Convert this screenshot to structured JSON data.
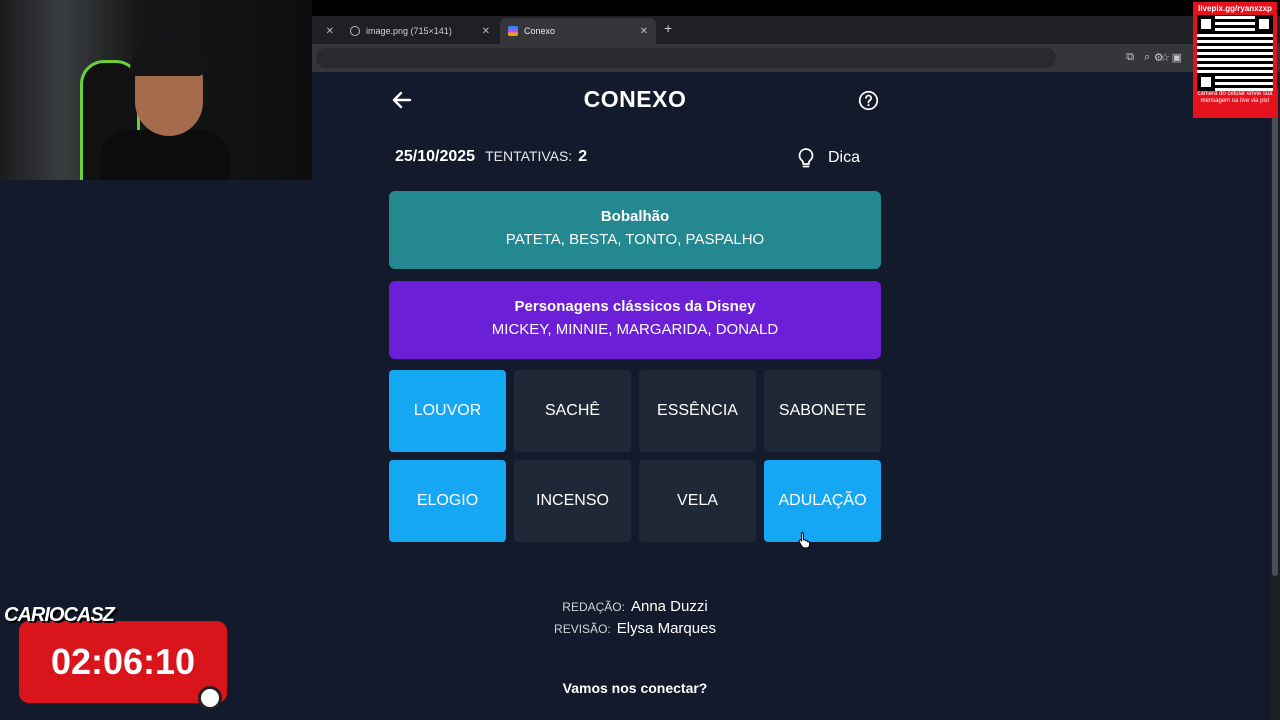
{
  "browser": {
    "tabs": [
      {
        "title": ""
      },
      {
        "title": "image.png (715×141)"
      },
      {
        "title": "Conexo"
      }
    ]
  },
  "game": {
    "title": "CONEXO",
    "date": "25/10/2025",
    "attempts_label": "TENTATIVAS:",
    "attempts_value": "2",
    "hint_label": "Dica",
    "groups": [
      {
        "title": "Bobalhão",
        "words": "PATETA, BESTA, TONTO, PASPALHO",
        "color": "#23888f"
      },
      {
        "title": "Personagens clássicos da Disney",
        "words": "MICKEY, MINNIE, MARGARIDA, DONALD",
        "color": "#6b1fd6"
      }
    ],
    "tiles": [
      {
        "word": "LOUVOR",
        "selected": true
      },
      {
        "word": "SACHÊ",
        "selected": false
      },
      {
        "word": "ESSÊNCIA",
        "selected": false
      },
      {
        "word": "SABONETE",
        "selected": false
      },
      {
        "word": "ELOGIO",
        "selected": true
      },
      {
        "word": "INCENSO",
        "selected": false
      },
      {
        "word": "VELA",
        "selected": false
      },
      {
        "word": "ADULAÇÃO",
        "selected": true
      }
    ],
    "credits": {
      "writing_label": "REDAÇÃO:",
      "writing_name": "Anna Duzzi",
      "review_label": "REVISÃO:",
      "review_name": "Elysa Marques"
    },
    "footer_question": "Vamos nos conectar?"
  },
  "overlay": {
    "qr_url": "livepix.gg/ryanxzxp",
    "qr_note": "câmera do celular envie sua mensagem na live via pix!",
    "timer_logo": "CARIOCASZ",
    "timer": "02:06:10"
  },
  "colors": {
    "selected_tile": "#15a7f3",
    "tile": "#1e2836",
    "background": "#121a2b"
  }
}
